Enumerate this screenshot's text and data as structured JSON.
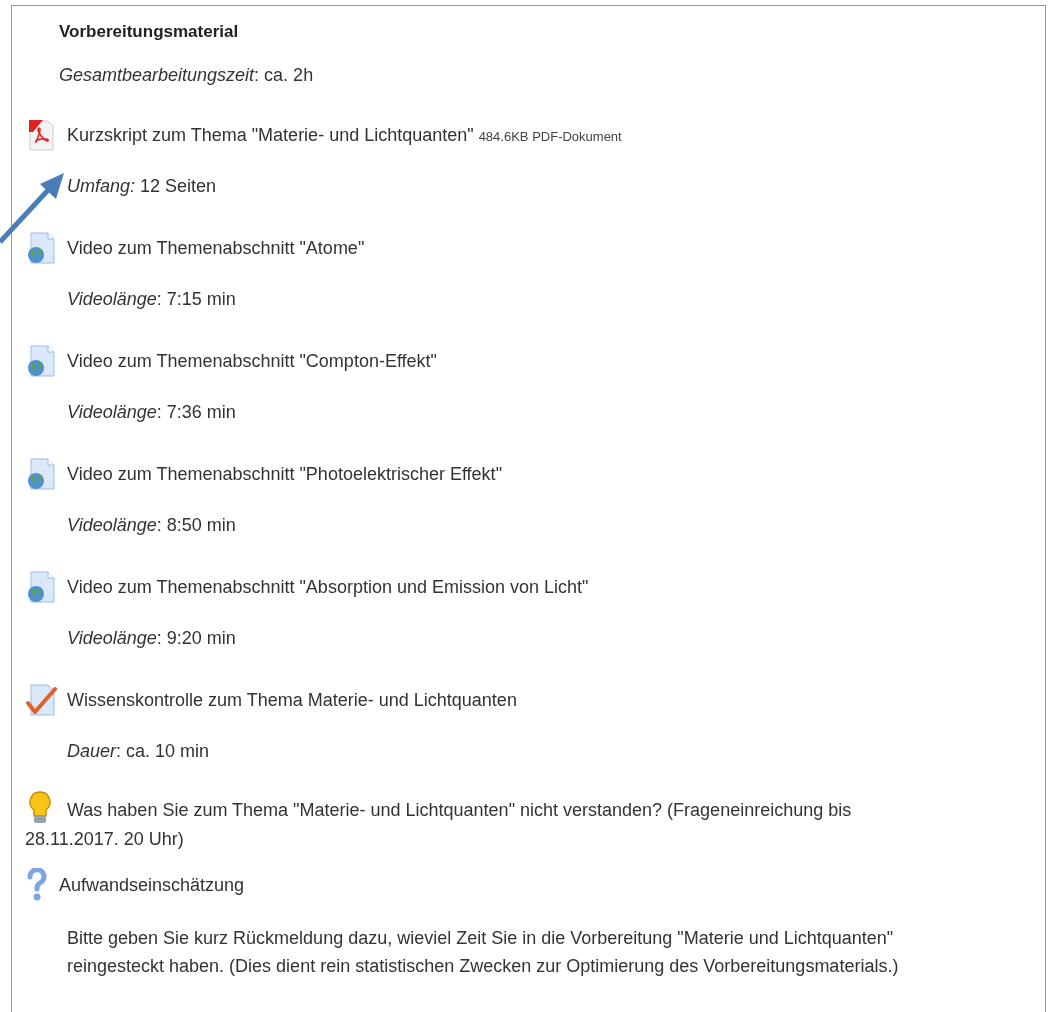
{
  "section": {
    "title": "Vorbereitungsmaterial",
    "intro": "*Gesamtbearbeitungszeit*: ca. 2h",
    "items": [
      {
        "kind": "pdf",
        "title": "Kurzskript zum Thema \"Materie- und Lichtquanten\"",
        "size": "484.6KB PDF-Dokument",
        "details": [
          "*Umfang:* 12 Seiten"
        ]
      },
      {
        "kind": "url",
        "title": "Video zum Themenabschnitt \"Atome\"",
        "details": [
          "*Videolänge*: 7:15 min"
        ]
      },
      {
        "kind": "url",
        "title": "Video zum Themenabschnitt \"Compton-Effekt\"",
        "details": [
          "*Videolänge*: 7:36 min"
        ]
      },
      {
        "kind": "url",
        "title": "Video zum Themenabschnitt \"Photoelektrischer Effekt\"",
        "details": [
          "*Videolänge*: 8:50 min"
        ]
      },
      {
        "kind": "url",
        "title": "Video zum Themenabschnitt \"Absorption und Emission von Licht\"",
        "details": [
          "*Videolänge*: 9:20 min"
        ]
      },
      {
        "kind": "quiz",
        "title": "Wissenskontrolle zum Thema Materie- und Lichtquanten",
        "details": [
          "*Dauer*: ca. 10 min"
        ]
      },
      {
        "kind": "idea",
        "title": "Was haben Sie zum Thema \"Materie- und Lichtquanten\" nicht verstanden? (Frageneinreichung bis 28.11.2017. 20 Uhr)"
      },
      {
        "kind": "feedback",
        "title": "Aufwandseinschätzung",
        "details": [
          "Bitte geben Sie kurz Rückmeldung dazu, wieviel Zeit Sie in die Vorbereitung \"Materie und Lichtquanten\" reingesteckt haben. (Dies dient rein statistischen Zwecken zur Optimierung des Vorbereitungsmaterials.)"
        ]
      }
    ]
  }
}
